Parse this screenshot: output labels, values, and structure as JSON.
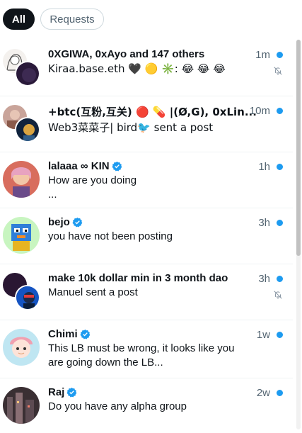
{
  "tabs": [
    {
      "label": "All",
      "active": true
    },
    {
      "label": "Requests",
      "active": false
    }
  ],
  "accent_color": "#1d9bf0",
  "conversations": [
    {
      "name": "0XGIWA, 0xAyo and 147 others",
      "message": "Kiraa.base.eth 🖤 🟡 ✳️: 😂 😂 😂",
      "time": "1m",
      "unread": true,
      "muted": true,
      "verified": false,
      "avatar": "group-avatar"
    },
    {
      "name": "+btc(互粉,互关) 🔴 💊 |(Ø,G), 0xLin...",
      "message": "Web3菜菜子| bird🐦 sent a post",
      "time": "10m",
      "unread": true,
      "muted": false,
      "verified": false,
      "avatar": "group-avatar"
    },
    {
      "name": "lalaaa ∞ KIN",
      "message_line1": "How are you doing",
      "message_line2": "...",
      "time": "1h",
      "unread": true,
      "muted": false,
      "verified": true,
      "avatar": "user-avatar"
    },
    {
      "name": "bejo",
      "message": "you have not been posting",
      "time": "3h",
      "unread": true,
      "muted": false,
      "verified": true,
      "avatar": "pixel-avatar"
    },
    {
      "name": "make  10k dollar min in 3 month dao",
      "message": "Manuel sent a post",
      "time": "3h",
      "unread": true,
      "muted": true,
      "verified": false,
      "avatar": "group-avatar"
    },
    {
      "name": "Chimi",
      "message_line1": "This LB must be wrong, it looks like you",
      "message_line2": "are going down the LB...",
      "time": "1w",
      "unread": true,
      "muted": false,
      "verified": true,
      "avatar": "anime-avatar"
    },
    {
      "name": "Raj",
      "message": "Do you have any alpha group",
      "time": "2w",
      "unread": true,
      "muted": false,
      "verified": true,
      "avatar": "city-avatar"
    }
  ]
}
